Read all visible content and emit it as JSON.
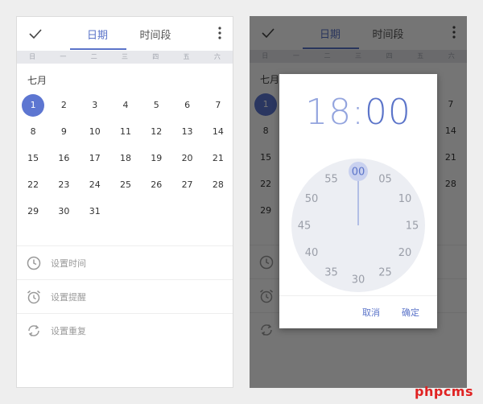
{
  "toolbar": {
    "tab_date": "日期",
    "tab_period": "时间段"
  },
  "weekdays": [
    "日",
    "一",
    "二",
    "三",
    "四",
    "五",
    "六"
  ],
  "calendar": {
    "month_label": "七月",
    "selected_day": 1,
    "days": [
      1,
      2,
      3,
      4,
      5,
      6,
      7,
      8,
      9,
      10,
      11,
      12,
      13,
      14,
      15,
      16,
      17,
      18,
      19,
      20,
      21,
      22,
      23,
      24,
      25,
      26,
      27,
      28,
      29,
      30,
      31
    ]
  },
  "settings": {
    "time": "设置时间",
    "reminder": "设置提醒",
    "repeat": "设置重复"
  },
  "time_picker": {
    "hour": "18",
    "separator": ":",
    "minute": "00",
    "minute_labels": [
      "00",
      "05",
      "10",
      "15",
      "20",
      "25",
      "30",
      "35",
      "40",
      "45",
      "50",
      "55"
    ],
    "selected_minute": "00",
    "cancel_label": "取消",
    "ok_label": "确定"
  },
  "colors": {
    "accent": "#5b74c9",
    "selected_day_bg": "#5d76d1",
    "clock_face": "#eceef3",
    "watermark": "#e02222"
  },
  "watermark": "phpcms"
}
